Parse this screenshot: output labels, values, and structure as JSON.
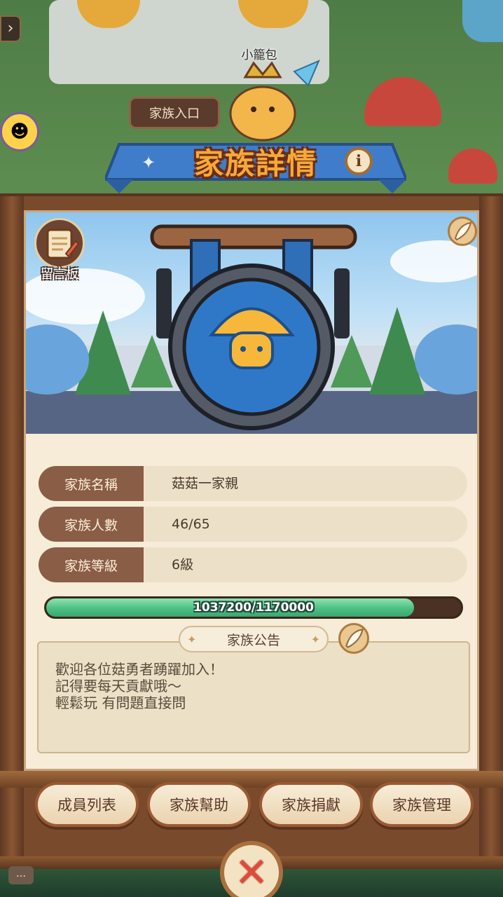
{
  "top_bar": {
    "back_icon": "chevron-right-icon",
    "back_glyph": "›",
    "npc_name": "小籠包",
    "family_entry_label": "家族入口"
  },
  "dialog": {
    "title": "家族詳情",
    "info_glyph": "i",
    "message_board_label": "留言板",
    "fields": [
      {
        "label": "家族名稱",
        "value": "菇菇一家親"
      },
      {
        "label": "家族人數",
        "value": "46/65"
      },
      {
        "label": "家族等級",
        "value": "6級"
      }
    ],
    "experience": {
      "current": 1037200,
      "max": 1170000,
      "text": "1037200/1170000"
    },
    "announcement": {
      "title": "家族公告",
      "text": "歡迎各位菇勇者踴躍加入！\n記得要每天貢獻哦～\n輕鬆玩 有問題直接問"
    },
    "actions": {
      "members": "成員列表",
      "help": "家族幫助",
      "donate": "家族捐獻",
      "manage": "家族管理"
    },
    "close_glyph": "✕"
  },
  "colors": {
    "title": "#f6a93a",
    "progress_fill": "#4cc082",
    "close": "#e04a3a",
    "wood": "#7a4a2c"
  }
}
